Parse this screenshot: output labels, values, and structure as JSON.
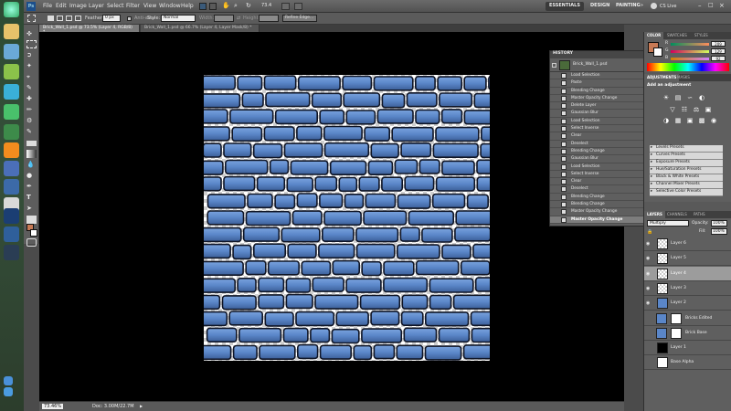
{
  "app": {
    "menus": [
      "File",
      "Edit",
      "Image",
      "Layer",
      "Select",
      "Filter",
      "View",
      "Window",
      "Help"
    ],
    "zoom_readout": "73.4",
    "workspaces": [
      "ESSENTIALS",
      "DESIGN",
      "PAINTING"
    ],
    "cs_live": "CS Live"
  },
  "options_bar": {
    "feather_label": "Feather:",
    "feather_value": "0 px",
    "antialias_label": "Anti-alias",
    "style_label": "Style:",
    "style_value": "Normal",
    "width_label": "Width:",
    "height_label": "Height:",
    "refine_edge_label": "Refine Edge..."
  },
  "tabs": [
    {
      "label": "Brick_Wall_1.psd @ 73.5% (Layer 4, RGB/8) *",
      "active": true
    },
    {
      "label": "Brick_Wall_1.psd @ 66.7% (Layer 4, Layer Mask/8) *",
      "active": false
    }
  ],
  "status": {
    "zoom": "73.46%",
    "doc": "Doc: 3.00M/22.7M"
  },
  "history": {
    "title": "HISTORY",
    "snapshot_name": "Brick_Wall_1.psd",
    "items": [
      "Load Selection",
      "Paste",
      "Blending Change",
      "Master Opacity Change",
      "Delete Layer",
      "Gaussian Blur",
      "Load Selection",
      "Select Inverse",
      "Clear",
      "Deselect",
      "Blending Change",
      "Gaussian Blur",
      "Load Selection",
      "Select Inverse",
      "Clear",
      "Deselect",
      "Blending Change",
      "Blending Change",
      "Master Opacity Change",
      "Master Opacity Change"
    ],
    "active_index": 19
  },
  "color_panel": {
    "tabs": [
      "COLOR",
      "SWATCHES",
      "STYLES"
    ],
    "fg_color": "#c87a55",
    "r": {
      "label": "R",
      "value": "209"
    },
    "g": {
      "label": "G",
      "value": "129"
    },
    "b": {
      "label": "B",
      "value": "92"
    }
  },
  "adjustments_panel": {
    "tabs": [
      "ADJUSTMENTS",
      "MASKS"
    ],
    "heading": "Add an adjustment",
    "presets": [
      "Levels Presets",
      "Curves Presets",
      "Exposure Presets",
      "Hue/Saturation Presets",
      "Black & White Presets",
      "Channel Mixer Presets",
      "Selective Color Presets"
    ]
  },
  "layers_panel": {
    "tabs": [
      "LAYERS",
      "CHANNELS",
      "PATHS"
    ],
    "blend_mode": "Multiply",
    "opacity_label": "Opacity:",
    "opacity_value": "100%",
    "fill_label": "Fill:",
    "fill_value": "100%",
    "layers": [
      {
        "name": "Layer 6",
        "visible": true,
        "thumb": "checker",
        "active": false,
        "mask": false
      },
      {
        "name": "Layer 5",
        "visible": true,
        "thumb": "checker",
        "active": false,
        "mask": false
      },
      {
        "name": "Layer 4",
        "visible": true,
        "thumb": "checker",
        "active": true,
        "mask": false
      },
      {
        "name": "Layer 3",
        "visible": true,
        "thumb": "checker",
        "active": false,
        "mask": false
      },
      {
        "name": "Layer 2",
        "visible": true,
        "thumb": "blue",
        "active": false,
        "mask": false
      },
      {
        "name": "Bricks Edited",
        "visible": false,
        "thumb": "blue",
        "active": false,
        "mask": true
      },
      {
        "name": "Brick Base",
        "visible": false,
        "thumb": "blue",
        "active": false,
        "mask": true
      },
      {
        "name": "Layer 1",
        "visible": false,
        "thumb": "black",
        "active": false,
        "mask": false
      },
      {
        "name": "Base Alpha",
        "visible": false,
        "thumb": "white",
        "active": false,
        "mask": false
      }
    ]
  },
  "colors": {
    "brick": "#5a86c8",
    "mortar": "#0f1526",
    "accent_fg": "#c87a55"
  }
}
